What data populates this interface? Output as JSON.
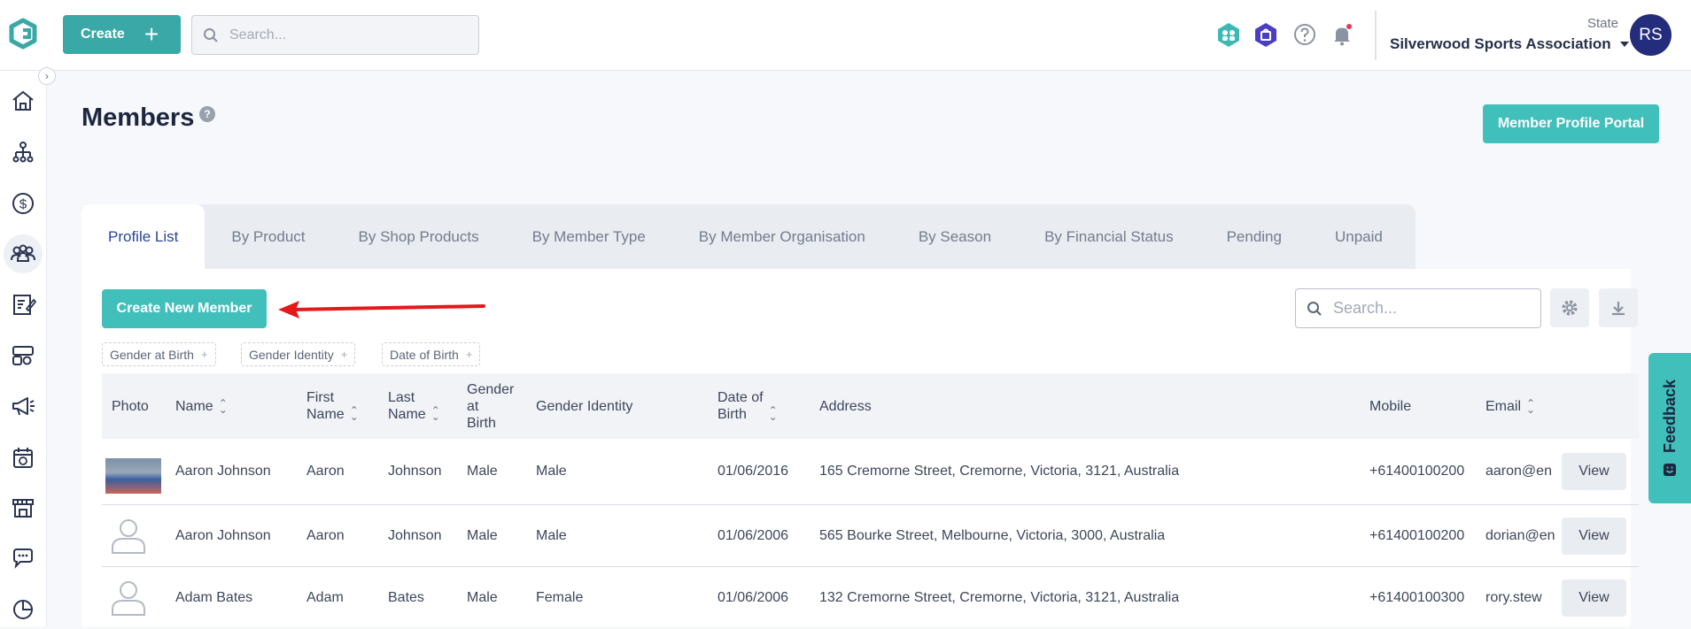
{
  "header": {
    "create_label": "Create",
    "search_placeholder": "Search...",
    "state_label": "State",
    "org_name": "Silverwood Sports Association",
    "avatar_initials": "RS"
  },
  "page": {
    "title": "Members",
    "portal_button": "Member Profile Portal"
  },
  "tabs": [
    "Profile List",
    "By Product",
    "By Shop Products",
    "By Member Type",
    "By Member Organisation",
    "By Season",
    "By Financial Status",
    "Pending",
    "Unpaid"
  ],
  "toolbar": {
    "create_new_member": "Create New Member",
    "search_placeholder": "Search..."
  },
  "filters": [
    "Gender at Birth",
    "Gender Identity",
    "Date of Birth"
  ],
  "table": {
    "headers": {
      "photo": "Photo",
      "name": "Name",
      "first_name_1": "First",
      "first_name_2": "Name",
      "last_name_1": "Last",
      "last_name_2": "Name",
      "gender_birth_1": "Gender",
      "gender_birth_2": "at",
      "gender_birth_3": "Birth",
      "gender_identity": "Gender Identity",
      "dob_1": "Date of",
      "dob_2": "Birth",
      "address": "Address",
      "mobile": "Mobile",
      "email": "Email"
    },
    "rows": [
      {
        "name": "Aaron Johnson",
        "first": "Aaron",
        "last": "Johnson",
        "gender_birth": "Male",
        "gender_identity": "Male",
        "dob": "01/06/2016",
        "address": "165 Cremorne Street, Cremorne, Victoria, 3121, Australia",
        "mobile": "+61400100200",
        "email": "aaron@en",
        "action": "View"
      },
      {
        "name": "Aaron Johnson",
        "first": "Aaron",
        "last": "Johnson",
        "gender_birth": "Male",
        "gender_identity": "Male",
        "dob": "01/06/2006",
        "address": "565 Bourke Street, Melbourne, Victoria, 3000, Australia",
        "mobile": "+61400100200",
        "email": "dorian@en",
        "action": "View"
      },
      {
        "name": "Adam Bates",
        "first": "Adam",
        "last": "Bates",
        "gender_birth": "Male",
        "gender_identity": "Female",
        "dob": "01/06/2006",
        "address": "132 Cremorne Street, Cremorne, Victoria, 3121, Australia",
        "mobile": "+61400100300",
        "email": "rory.stew",
        "action": "View"
      }
    ]
  },
  "feedback_label": "Feedback",
  "colors": {
    "teal": "#41bfbb",
    "navy": "#242c7c",
    "tab_active_text": "#2b4596",
    "arrow_red": "#e3191b"
  }
}
